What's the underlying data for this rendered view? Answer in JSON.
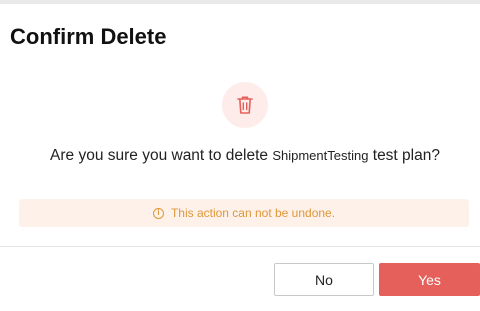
{
  "dialog": {
    "title": "Confirm Delete",
    "icon": "trash-icon",
    "message_prefix": "Are you sure you want to delete ",
    "item_name": "ShipmentTesting",
    "message_suffix": " test plan?",
    "warning": "This action can not be undone.",
    "warning_icon": "info-icon",
    "no_label": "No",
    "yes_label": "Yes"
  },
  "colors": {
    "danger": "#e5605a",
    "warning_text": "#e0973a",
    "warning_bg": "#fdf1ea",
    "icon_bg": "#fdecea"
  }
}
